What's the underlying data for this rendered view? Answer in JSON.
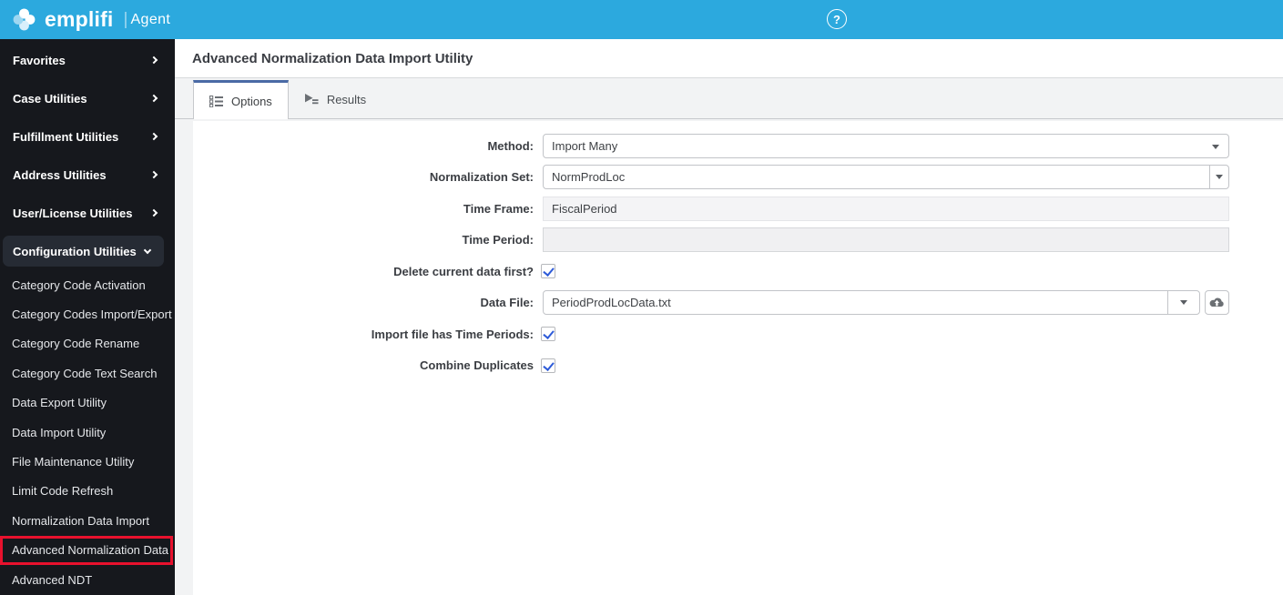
{
  "header": {
    "brand": "emplifi",
    "divider": "|",
    "product": "Agent",
    "help_glyph": "?",
    "bg_color": "#2ca9de",
    "icons": [
      "emplifi-flower-logo",
      "help-circle-icon"
    ]
  },
  "sidebar": {
    "top_items": [
      {
        "label": "Favorites",
        "expanded": false
      },
      {
        "label": "Case Utilities",
        "expanded": false
      },
      {
        "label": "Fulfillment Utilities",
        "expanded": false
      },
      {
        "label": "Address Utilities",
        "expanded": false
      },
      {
        "label": "User/License Utilities",
        "expanded": false
      },
      {
        "label": "Configuration Utilities",
        "expanded": true
      }
    ],
    "sub_items": [
      {
        "label": "Category Code Activation"
      },
      {
        "label": "Category Codes Import/Export"
      },
      {
        "label": "Category Code Rename"
      },
      {
        "label": "Category Code Text Search"
      },
      {
        "label": "Data Export Utility"
      },
      {
        "label": "Data Import Utility"
      },
      {
        "label": "File Maintenance Utility"
      },
      {
        "label": "Limit Code Refresh"
      },
      {
        "label": "Normalization Data Import"
      },
      {
        "label": "Advanced Normalization Data",
        "highlighted": true
      },
      {
        "label": "Advanced NDT"
      }
    ],
    "highlight_color": "#e8112d"
  },
  "main": {
    "title": "Advanced Normalization Data Import Utility",
    "tabs": [
      {
        "label": "Options",
        "icon": "options-list-icon",
        "active": true
      },
      {
        "label": "Results",
        "icon": "run-results-icon",
        "active": false
      }
    ],
    "tab_accent_color": "#4a6aa5",
    "checkbox_color": "#2e5bd8",
    "form": {
      "method": {
        "label": "Method:",
        "value": "Import Many",
        "control": "select"
      },
      "normalization_set": {
        "label": "Normalization Set:",
        "value": "NormProdLoc",
        "control": "combobox"
      },
      "time_frame": {
        "label": "Time Frame:",
        "value": "FiscalPeriod",
        "control": "readonly"
      },
      "time_period": {
        "label": "Time Period:",
        "value": "",
        "control": "readonly"
      },
      "delete_first": {
        "label": "Delete current data first?",
        "checked": true,
        "control": "checkbox"
      },
      "data_file": {
        "label": "Data File:",
        "value": "PeriodProdLocData.txt",
        "control": "combobox",
        "upload_icon": "cloud-upload-icon"
      },
      "import_time_periods": {
        "label": "Import file has Time Periods:",
        "checked": true,
        "control": "checkbox"
      },
      "combine_duplicates": {
        "label": "Combine Duplicates",
        "checked": true,
        "control": "checkbox"
      }
    }
  }
}
